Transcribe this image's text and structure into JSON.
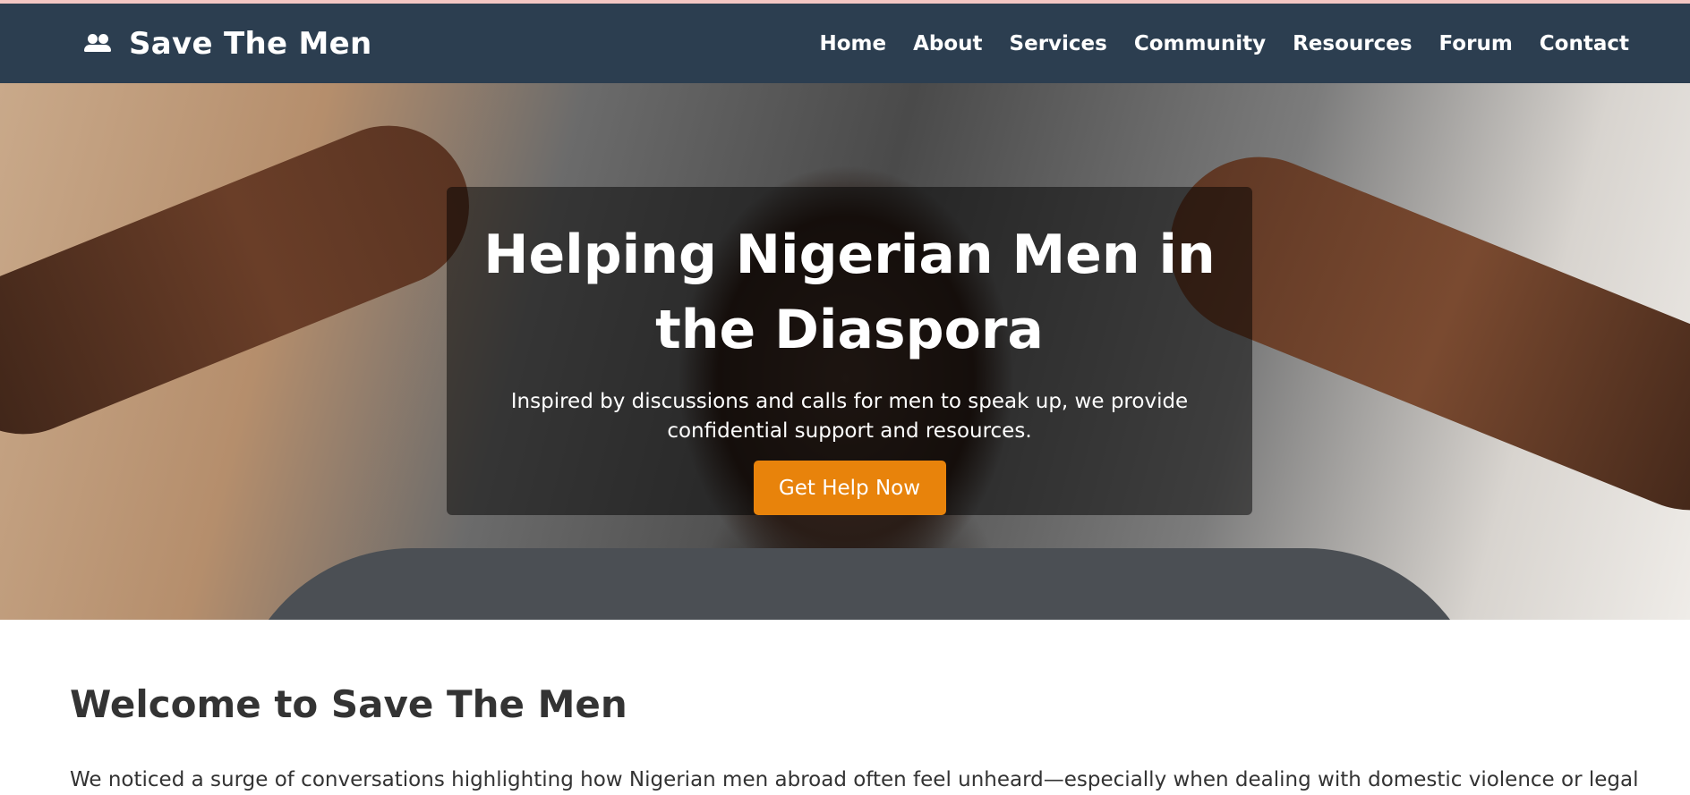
{
  "brand": {
    "name": "Save The Men",
    "logo_icon": "users-icon"
  },
  "nav": {
    "items": [
      {
        "label": "Home"
      },
      {
        "label": "About"
      },
      {
        "label": "Services"
      },
      {
        "label": "Community"
      },
      {
        "label": "Resources"
      },
      {
        "label": "Forum"
      },
      {
        "label": "Contact"
      }
    ]
  },
  "hero": {
    "title": "Helping Nigerian Men in the Diaspora",
    "subtitle": "Inspired by discussions and calls for men to speak up, we provide confidential support and resources.",
    "cta_label": "Get Help Now",
    "image_description": "man lying down with hands on his head"
  },
  "welcome": {
    "heading": "Welcome to Save The Men",
    "text": "We noticed a surge of conversations highlighting how Nigerian men abroad often feel unheard—especially when dealing with domestic violence or legal"
  },
  "colors": {
    "navbar": "#2c3e50",
    "accent": "#e8830b",
    "text": "#333333",
    "top_line": "#f4c7c3"
  }
}
